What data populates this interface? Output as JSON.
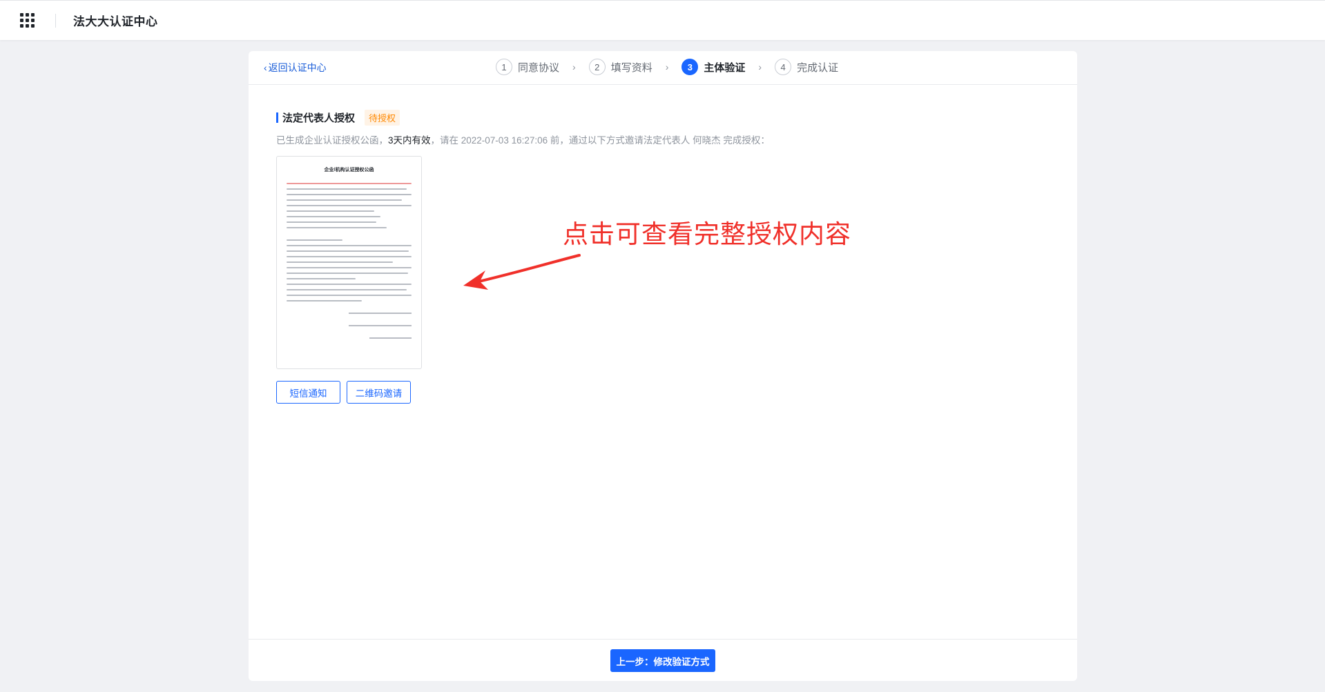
{
  "app": {
    "title": "法大大认证中心",
    "menu_icon": "grid-icon"
  },
  "header": {
    "back_label": "返回认证中心",
    "steps": [
      {
        "num": "1",
        "label": "同意协议",
        "active": false
      },
      {
        "num": "2",
        "label": "填写资料",
        "active": false
      },
      {
        "num": "3",
        "label": "主体验证",
        "active": true
      },
      {
        "num": "4",
        "label": "完成认证",
        "active": false
      }
    ]
  },
  "section": {
    "title": "法定代表人授权",
    "status": "待授权",
    "desc_prefix": "已生成企业认证授权公函，",
    "desc_validity": "3天内有效",
    "desc_middle": "，请在 2022-07-03 16:27:06 前，通过以下方式邀请法定代表人 何晓杰 完成授权："
  },
  "document": {
    "title": "企业/机构认证授权公函"
  },
  "annotation": {
    "text": "点击可查看完整授权内容"
  },
  "actions": {
    "sms_label": "短信通知",
    "qr_label": "二维码邀请"
  },
  "footer": {
    "prev_label": "上一步：修改验证方式"
  },
  "colors": {
    "accent": "#1a66ff",
    "warning": "#ff8800",
    "annotation": "#f0302a"
  }
}
